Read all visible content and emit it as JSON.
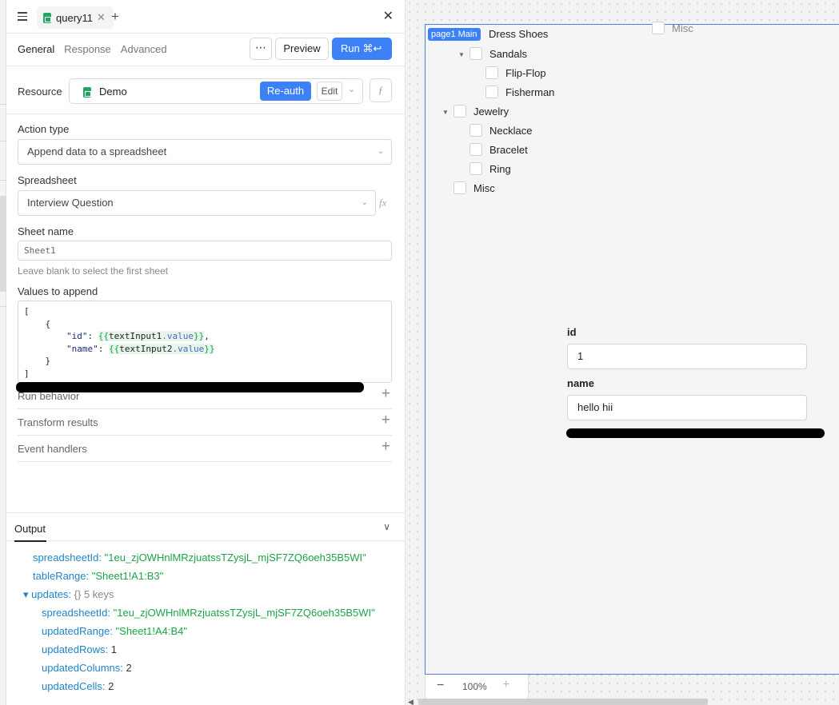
{
  "tab": {
    "name": "query11"
  },
  "subtabs": [
    "General",
    "Response",
    "Advanced"
  ],
  "toolbar": {
    "more": "⋯",
    "preview": "Preview",
    "run": "Run ⌘↩"
  },
  "resource": {
    "label": "Resource",
    "name": "Demo",
    "reauth": "Re-auth",
    "edit": "Edit"
  },
  "action_type": {
    "label": "Action type",
    "value": "Append data to a spreadsheet"
  },
  "spreadsheet": {
    "label": "Spreadsheet",
    "value": "Interview Question"
  },
  "sheet_name": {
    "label": "Sheet name",
    "placeholder": "Sheet1",
    "hint": "Leave blank to select the first sheet"
  },
  "values": {
    "label": "Values to append",
    "code": {
      "l1": "[",
      "l2": "    {",
      "k1": "\"id\"",
      "tpl1_open": "{{",
      "tpl1_var": "textInput1",
      "tpl1_prop": ".value",
      "tpl1_close": "}}",
      "k2": "\"name\"",
      "tpl2_var": "textInput2",
      "l5": "    }",
      "l6": "]"
    }
  },
  "sections": [
    "Run behavior",
    "Transform results",
    "Event handlers"
  ],
  "output": {
    "title": "Output",
    "spreadsheetId_key": "spreadsheetId:",
    "spreadsheetId_val": "\"1eu_zjOWHnlMRzjuatssTZysjL_mjSF7ZQ6oeh35B5WI\"",
    "tableRange_key": "tableRange:",
    "tableRange_val": "\"Sheet1!A1:B3\"",
    "updates_key": "updates:",
    "updates_meta": "{} 5 keys",
    "u_spreadsheetId_key": "spreadsheetId:",
    "u_spreadsheetId_val": "\"1eu_zjOWHnlMRzjuatssTZysjL_mjSF7ZQ6oeh35B5WI\"",
    "u_updatedRange_key": "updatedRange:",
    "u_updatedRange_val": "\"Sheet1!A4:B4\"",
    "u_updatedRows_key": "updatedRows:",
    "u_updatedRows_val": "1",
    "u_updatedColumns_key": "updatedColumns:",
    "u_updatedColumns_val": "2",
    "u_updatedCells_key": "updatedCells:",
    "u_updatedCells_val": "2"
  },
  "canvas": {
    "page_badge": "page1 Main",
    "misc_top": "Misc",
    "tree": [
      "Dress Shoes",
      "Sandals",
      "Flip-Flop",
      "Fisherman",
      "Jewelry",
      "Necklace",
      "Bracelet",
      "Ring",
      "Misc"
    ],
    "id_label": "id",
    "id_value": "1",
    "name_label": "name",
    "name_value": "hello hii",
    "zoom": "100%"
  }
}
